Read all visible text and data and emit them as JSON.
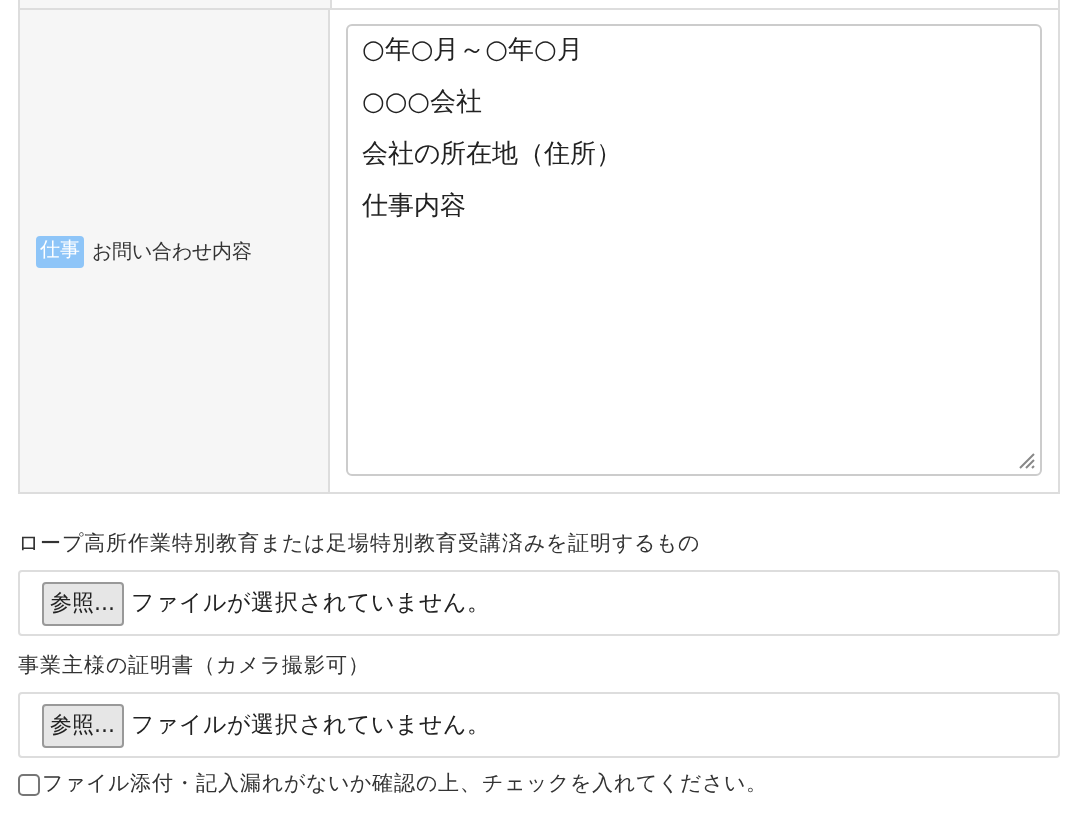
{
  "form_row": {
    "label": "お問い合わせ内容",
    "badge": "仕事",
    "lines": [
      "○年○月～○年○月",
      "○○○会社",
      "会社の所在地（住所）",
      "仕事内容"
    ]
  },
  "uploads": [
    {
      "label": "ロープ高所作業特別教育または足場特別教育受講済みを証明するもの",
      "button": "参照...",
      "status": "ファイルが選択されていません。"
    },
    {
      "label": "事業主様の証明書（カメラ撮影可）",
      "button": "参照...",
      "status": "ファイルが選択されていません。"
    }
  ],
  "confirm": {
    "label": "ファイル添付・記入漏れがないか確認の上、チェックを入れてください。",
    "checked": false
  }
}
